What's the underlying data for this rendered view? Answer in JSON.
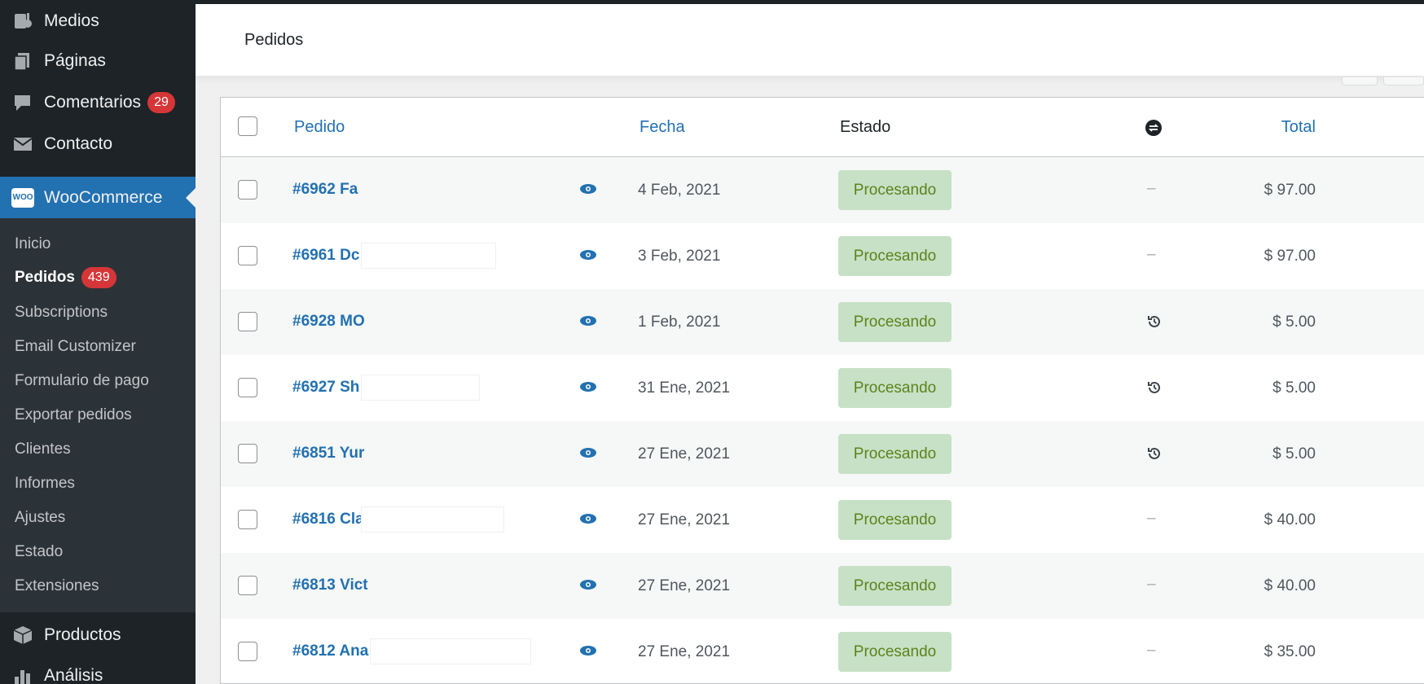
{
  "sidebar": {
    "items_top": [
      {
        "label": "Medios",
        "icon": "media-icon"
      },
      {
        "label": "Páginas",
        "icon": "pages-icon"
      },
      {
        "label": "Comentarios",
        "icon": "comments-icon",
        "badge": "29"
      },
      {
        "label": "Contacto",
        "icon": "mail-icon"
      }
    ],
    "woocommerce": {
      "label": "WooCommerce",
      "logo_text": "WOO"
    },
    "submenu": [
      {
        "label": "Inicio"
      },
      {
        "label": "Pedidos",
        "badge": "439",
        "current": true
      },
      {
        "label": "Subscriptions"
      },
      {
        "label": "Email Customizer"
      },
      {
        "label": "Formulario de pago"
      },
      {
        "label": "Exportar pedidos"
      },
      {
        "label": "Clientes"
      },
      {
        "label": "Informes"
      },
      {
        "label": "Ajustes"
      },
      {
        "label": "Estado"
      },
      {
        "label": "Extensiones"
      }
    ],
    "items_bottom": [
      {
        "label": "Productos",
        "icon": "products-icon"
      },
      {
        "label": "Análisis",
        "icon": "analytics-icon"
      }
    ]
  },
  "header": {
    "title": "Pedidos"
  },
  "table": {
    "columns": {
      "order": "Pedido",
      "date": "Fecha",
      "status": "Estado",
      "total": "Total",
      "subscription_icon": "subscription-icon"
    },
    "rows": [
      {
        "order": "#6962 Fa",
        "date": "4 Feb, 2021",
        "status": "Procesando",
        "sub": "–",
        "total": "$ 97.00"
      },
      {
        "order": "#6961 Dc",
        "date": "3 Feb, 2021",
        "status": "Procesando",
        "sub": "–",
        "total": "$ 97.00"
      },
      {
        "order": "#6928 MO",
        "date": "1 Feb, 2021",
        "status": "Procesando",
        "sub": "history",
        "total": "$ 5.00"
      },
      {
        "order": "#6927 Sh",
        "date": "31 Ene, 2021",
        "status": "Procesando",
        "sub": "history",
        "total": "$ 5.00"
      },
      {
        "order": "#6851 Yur",
        "date": "27 Ene, 2021",
        "status": "Procesando",
        "sub": "history",
        "total": "$ 5.00"
      },
      {
        "order": "#6816 Cla",
        "date": "27 Ene, 2021",
        "status": "Procesando",
        "sub": "–",
        "total": "$ 40.00"
      },
      {
        "order": "#6813 Vict",
        "date": "27 Ene, 2021",
        "status": "Procesando",
        "sub": "–",
        "total": "$ 40.00"
      },
      {
        "order": "#6812 Ana",
        "date": "27 Ene, 2021",
        "status": "Procesando",
        "sub": "–",
        "total": "$ 35.00"
      }
    ]
  },
  "colors": {
    "sidebar_bg": "#1d2327",
    "accent": "#2271b1",
    "badge": "#d63638",
    "status_bg": "#c6e1c6",
    "status_text": "#5b841b"
  }
}
